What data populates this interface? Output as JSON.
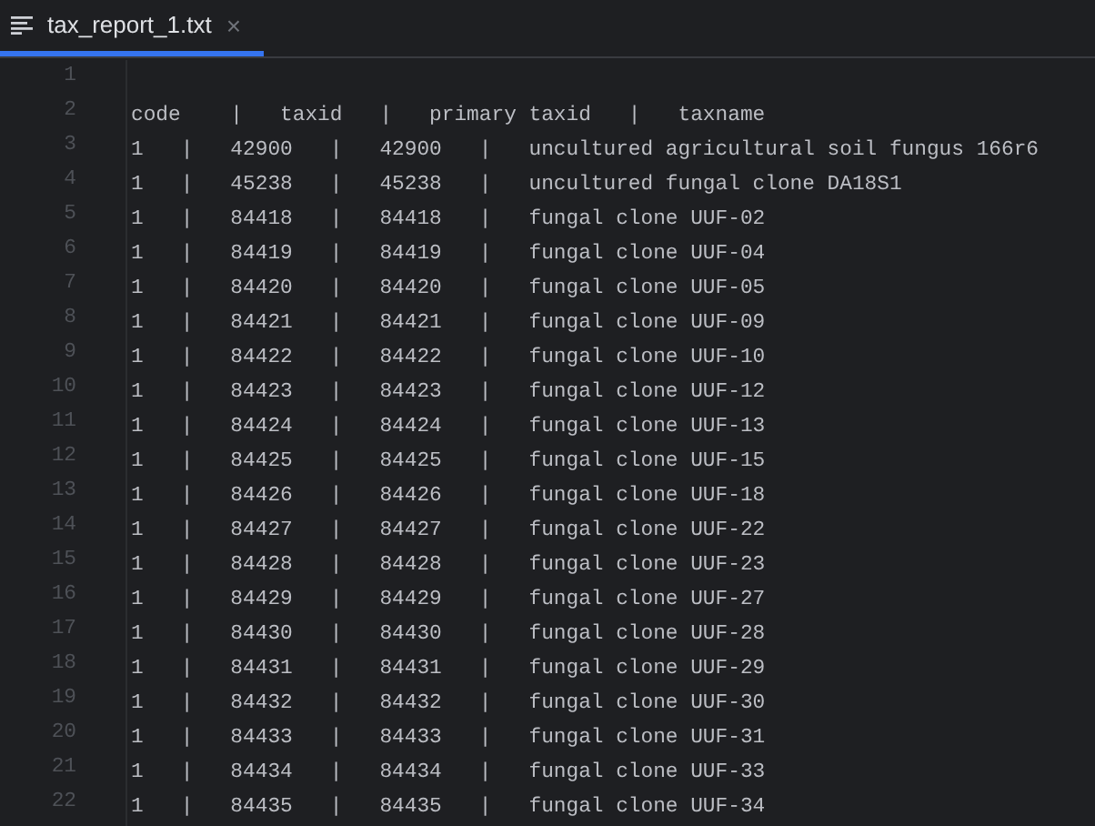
{
  "tabs": [
    {
      "title": "tax_report_1.txt",
      "close": "×",
      "selected": true
    }
  ],
  "editor": {
    "lines": [
      {
        "number": "1"
      },
      {
        "number": "2",
        "text": "code    |   taxid   |   primary taxid   |   taxname"
      },
      {
        "number": "3",
        "text": "1   |   42900   |   42900   |   uncultured agricultural soil fungus 166r6"
      },
      {
        "number": "4",
        "text": "1   |   45238   |   45238   |   uncultured fungal clone DA18S1"
      },
      {
        "number": "5",
        "text": "1   |   84418   |   84418   |   fungal clone UUF-02"
      },
      {
        "number": "6",
        "text": "1   |   84419   |   84419   |   fungal clone UUF-04"
      },
      {
        "number": "7",
        "text": "1   |   84420   |   84420   |   fungal clone UUF-05"
      },
      {
        "number": "8",
        "text": "1   |   84421   |   84421   |   fungal clone UUF-09"
      },
      {
        "number": "9",
        "text": "1   |   84422   |   84422   |   fungal clone UUF-10"
      },
      {
        "number": "10",
        "text": "1   |   84423   |   84423   |   fungal clone UUF-12"
      },
      {
        "number": "11",
        "text": "1   |   84424   |   84424   |   fungal clone UUF-13"
      },
      {
        "number": "12",
        "text": "1   |   84425   |   84425   |   fungal clone UUF-15"
      },
      {
        "number": "13",
        "text": "1   |   84426   |   84426   |   fungal clone UUF-18"
      },
      {
        "number": "14",
        "text": "1   |   84427   |   84427   |   fungal clone UUF-22"
      },
      {
        "number": "15",
        "text": "1   |   84428   |   84428   |   fungal clone UUF-23"
      },
      {
        "number": "16",
        "text": "1   |   84429   |   84429   |   fungal clone UUF-27"
      },
      {
        "number": "17",
        "text": "1   |   84430   |   84430   |   fungal clone UUF-28"
      },
      {
        "number": "18",
        "text": "1   |   84431   |   84431   |   fungal clone UUF-29"
      },
      {
        "number": "19",
        "text": "1   |   84432   |   84432   |   fungal clone UUF-30"
      },
      {
        "number": "20",
        "text": "1   |   84433   |   84433   |   fungal clone UUF-31"
      },
      {
        "number": "21",
        "text": "1   |   84434   |   84434   |   fungal clone UUF-33"
      },
      {
        "number": "22",
        "text": "1   |   84435   |   84435   |   fungal clone UUF-34"
      }
    ]
  }
}
